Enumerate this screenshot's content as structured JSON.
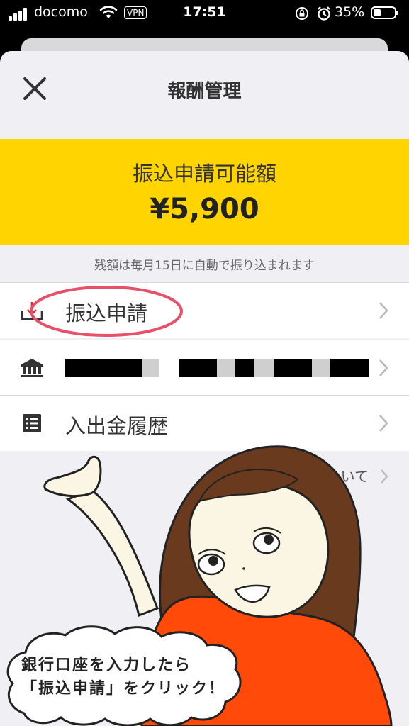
{
  "status_bar": {
    "carrier": "docomo",
    "vpn": "VPN",
    "time": "17:51",
    "battery": "35%",
    "battery_level": 0.35
  },
  "header": {
    "title": "報酬管理",
    "close_icon": "close-icon"
  },
  "banner": {
    "label": "振込申請可能額",
    "amount": "¥5,900",
    "color": "#ffd400"
  },
  "note": "残額は毎月15日に自動で振り込まれます",
  "menu": [
    {
      "label": "振込申請",
      "icon": "download-icon"
    },
    {
      "label": "",
      "icon": "bank-icon"
    },
    {
      "label": "入出金履歴",
      "icon": "list-icon"
    }
  ],
  "about_link": "について",
  "bubble_text": [
    "銀行口座を入力したら",
    "「振込申請」をクリック！"
  ],
  "colors": {
    "accent": "#ffd400",
    "highlight": "#e8506a",
    "shirt": "#ff4a0a",
    "hair": "#6a3a1f"
  }
}
